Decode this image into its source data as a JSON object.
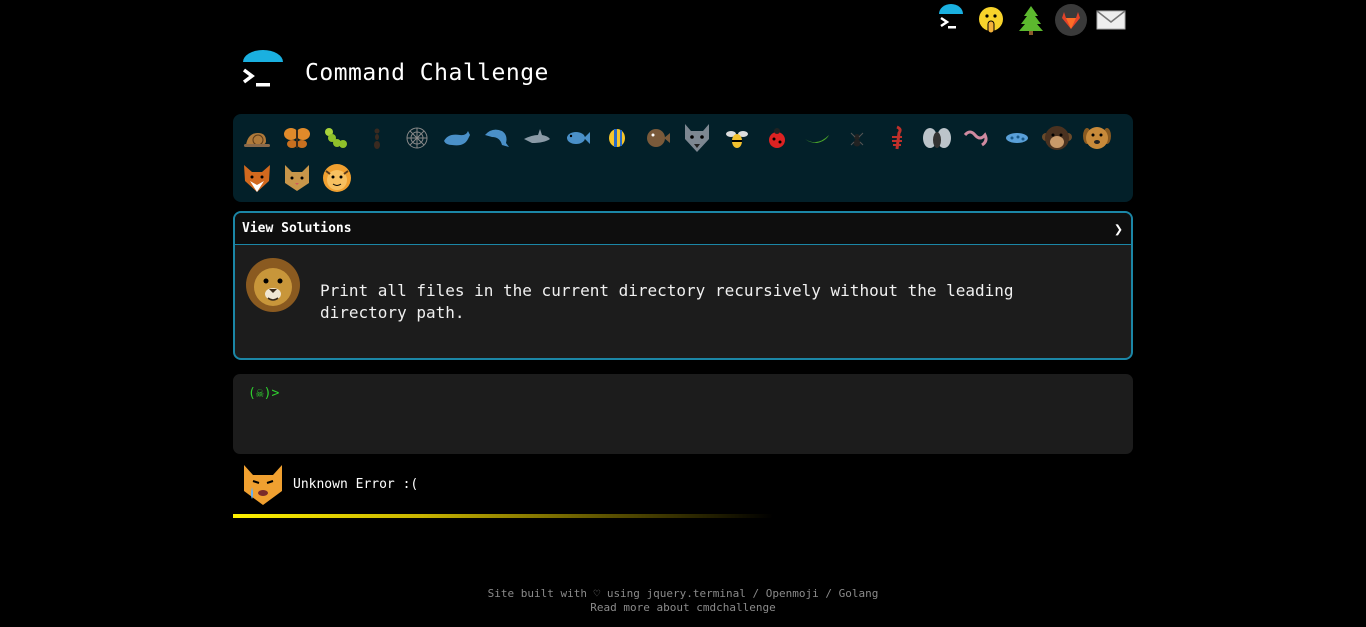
{
  "header": {
    "title": "Command Challenge"
  },
  "top_nav": [
    {
      "name": "cmdchallenge-icon"
    },
    {
      "name": "shushing-face-icon"
    },
    {
      "name": "tree-icon"
    },
    {
      "name": "gitlab-icon"
    },
    {
      "name": "mail-icon"
    }
  ],
  "challenges": [
    "snail",
    "butterfly",
    "caterpillar",
    "ant",
    "spider-web",
    "whale",
    "dolphin",
    "shark",
    "fish",
    "tropical-fish",
    "pufferfish",
    "wolf",
    "bee",
    "lady-beetle",
    "cucumber",
    "spider",
    "scorpion",
    "fly",
    "worm",
    "microbe",
    "monkey",
    "dog",
    "fox",
    "cat",
    "tiger"
  ],
  "solutions": {
    "label": "View Solutions",
    "chevron": "❯",
    "description": "Print all files in the current directory recursively without the leading directory path."
  },
  "terminal": {
    "prompt": "(☠)>"
  },
  "status": {
    "text": "Unknown Error :(",
    "progress": 0.55
  },
  "footer": {
    "line1_prefix": "Site built with ♡ using ",
    "link_jquery": "jquery.terminal",
    "sep1": " / ",
    "link_openmoji": "Openmoji",
    "sep2": " / ",
    "link_golang": "Golang",
    "line2": "Read more about cmdchallenge"
  },
  "colors": {
    "accent_blue": "#1b86a6",
    "bar_bg": "#032029",
    "prompt_green": "#2fd12f",
    "progress_yellow": "#fff200"
  }
}
